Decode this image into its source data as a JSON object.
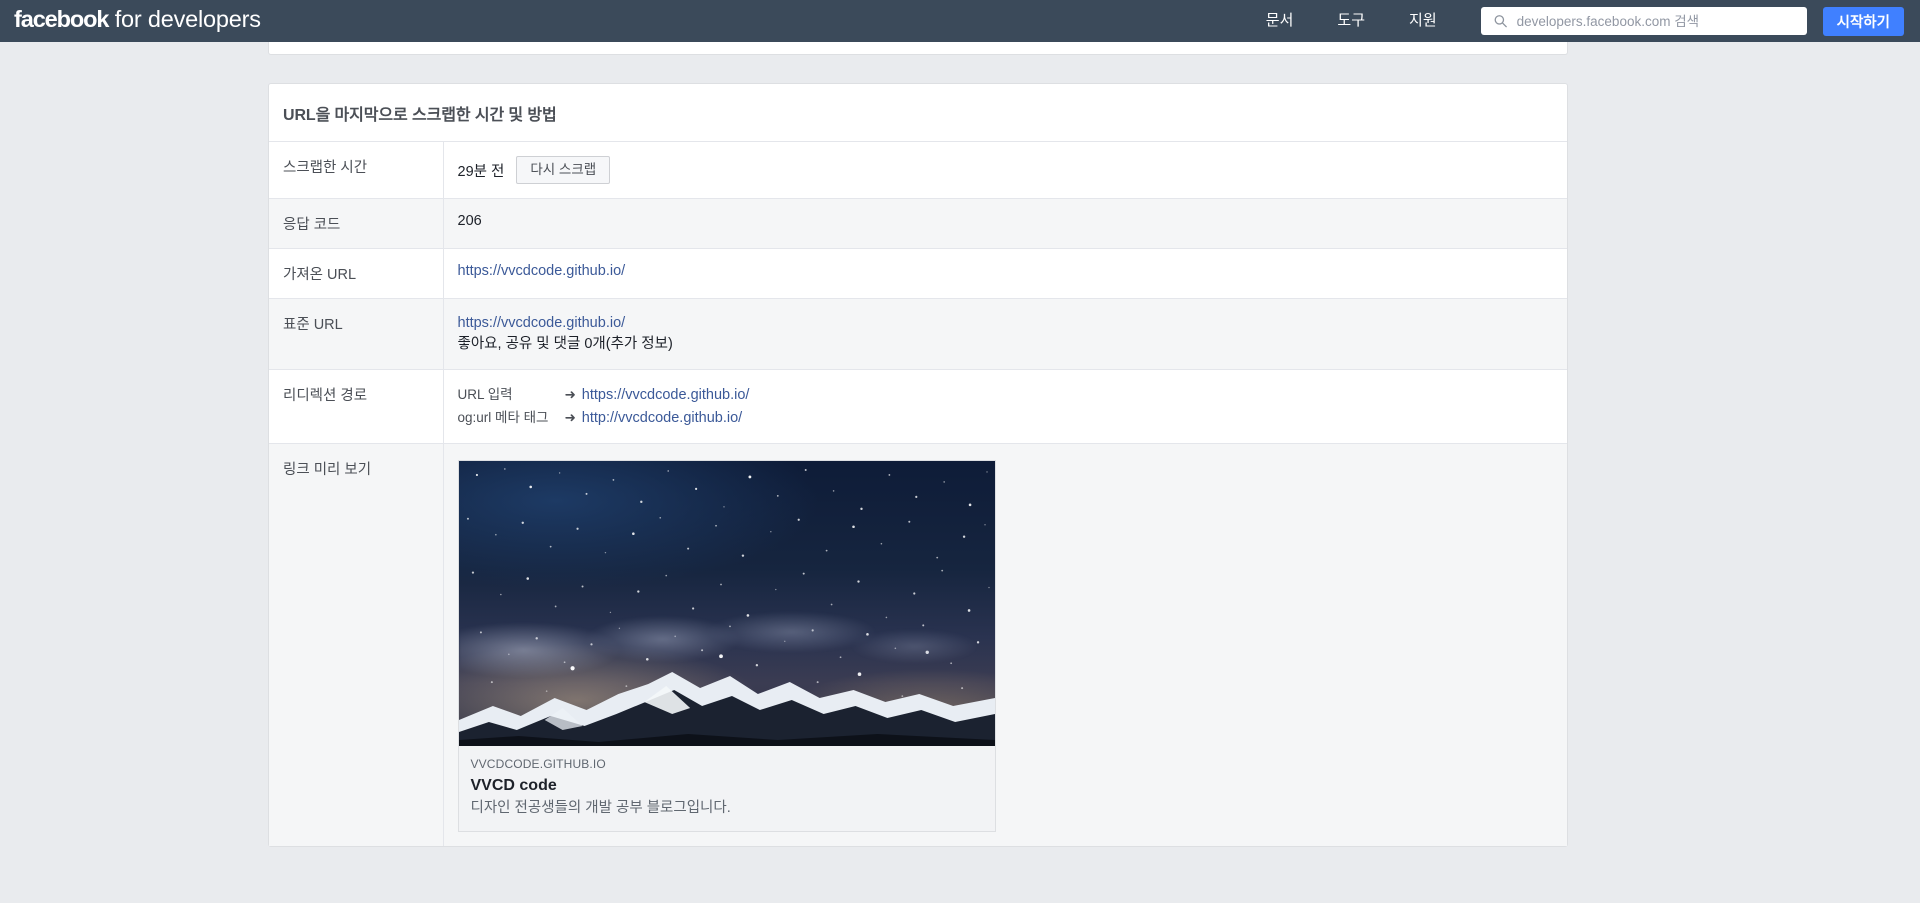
{
  "header": {
    "brand_bold": "facebook",
    "brand_rest": " for developers",
    "nav": [
      {
        "label": "문서"
      },
      {
        "label": "도구"
      },
      {
        "label": "지원"
      }
    ],
    "search": {
      "placeholder": "developers.facebook.com 검색",
      "value": "",
      "icon": "search-icon"
    },
    "cta_label": "시작하기",
    "background_color": "#3b4a5a",
    "cta_color": "#4080ff"
  },
  "card": {
    "title": "URL을 마지막으로 스크랩한 시간 및 방법",
    "rows": {
      "scraped_at": {
        "key": "스크랩한 시간",
        "value": "29분 전",
        "button_label": "다시 스크랩"
      },
      "response_code": {
        "key": "응답 코드",
        "value": "206"
      },
      "fetched_url": {
        "key": "가져온 URL",
        "value": "https://vvcdcode.github.io/"
      },
      "canonical_url": {
        "key": "표준 URL",
        "value": "https://vvcdcode.github.io/",
        "engagement": "좋아요, 공유 및 댓글 0개(추가 정보)"
      },
      "redirect_path": {
        "key": "리디렉션 경로",
        "steps": [
          {
            "label": "URL 입력",
            "arrow": "➜",
            "target": "https://vvcdcode.github.io/"
          },
          {
            "label": "og:url 메타 태그",
            "arrow": "➜",
            "target": "http://vvcdcode.github.io/"
          }
        ]
      },
      "link_preview": {
        "key": "링크 미리 보기",
        "preview": {
          "domain": "VVCDCODE.GITHUB.IO",
          "title": "VVCD code",
          "description": "디자인 전공생들의 개발 공부 블로그입니다.",
          "image_alt": "night-sky-over-snowy-mountains"
        }
      }
    }
  },
  "colors": {
    "link": "#3b5998",
    "page_background": "#e9ebee",
    "card_background": "#ffffff",
    "row_alt_background": "#f5f6f7"
  }
}
